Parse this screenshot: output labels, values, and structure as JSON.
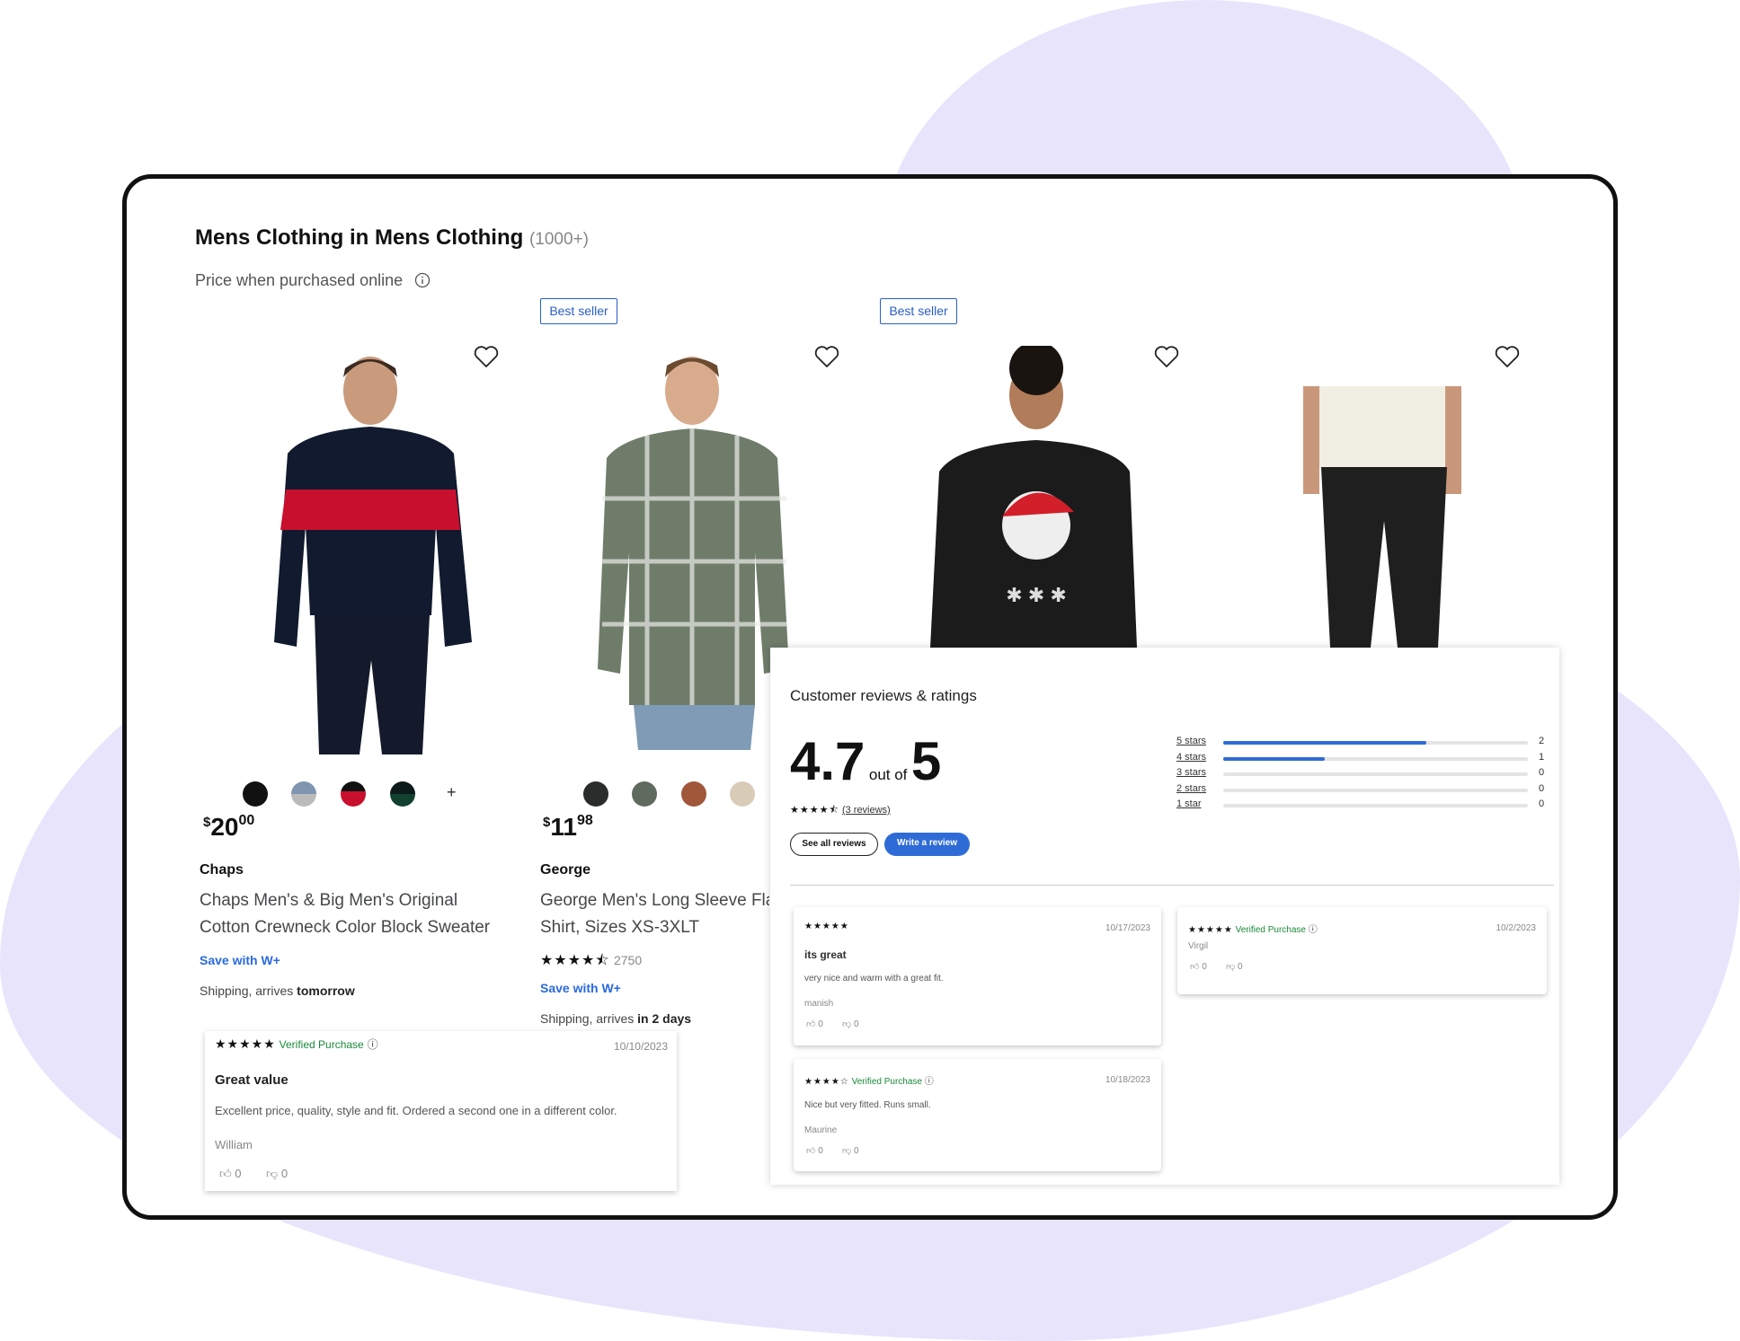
{
  "page": {
    "title": "Mens Clothing in Mens Clothing",
    "count": "(1000+)",
    "subtitle": "Price when purchased online",
    "info_icon": "info-icon"
  },
  "colors": {
    "accent": "#2a6ae0",
    "background_blob": "#e8e4fc",
    "verified": "#1a8a3a"
  },
  "products": [
    {
      "badge": "",
      "brand": "Chaps",
      "price_dollars": "20",
      "price_cents": "00",
      "name_line1": "Chaps Men's & Big Men's Original",
      "name_line2": "Cotton Crewneck Color Block Sweater",
      "rating_text": "",
      "save": "Save with W+",
      "shipping_prefix": "Shipping, arrives ",
      "shipping_bold": "tomorrow",
      "swatches": [
        "#111111",
        "#7f95b0",
        "#c8102e",
        "#12322a"
      ],
      "more_swatches": "+"
    },
    {
      "badge": "Best seller",
      "brand": "George",
      "price_dollars": "11",
      "price_cents": "98",
      "name_line1": "George Men's Long Sleeve Fla",
      "name_line2": "Shirt, Sizes XS-3XLT",
      "rating_stars": "★★★★⯪",
      "rating_count": "2750",
      "save": "Save with W+",
      "shipping_prefix": "Shipping, arrives ",
      "shipping_bold": "in 2 days",
      "swatches": [
        "#2b2d2c",
        "#5f6b5e",
        "#a0573a",
        "#d8cbb8"
      ]
    },
    {
      "badge": "Best seller"
    },
    {
      "badge": ""
    }
  ],
  "floating_review": {
    "stars": "★★★★★",
    "verified": "Verified Purchase",
    "date": "10/10/2023",
    "title": "Great value",
    "body": "Excellent price, quality, style and fit. Ordered a second one in a different color.",
    "author": "William",
    "up": "0",
    "down": "0"
  },
  "reviews_panel": {
    "heading": "Customer reviews & ratings",
    "rating": "4.7",
    "out_of": "out of",
    "max": "5",
    "stars": "★★★★⯪",
    "review_count": "(3 reviews)",
    "see_all": "See all reviews",
    "write": "Write a review",
    "histogram": [
      {
        "label": "5 stars",
        "count": "2",
        "fraction": 0.667
      },
      {
        "label": "4 stars",
        "count": "1",
        "fraction": 0.333
      },
      {
        "label": "3 stars",
        "count": "0",
        "fraction": 0
      },
      {
        "label": "2 stars",
        "count": "0",
        "fraction": 0
      },
      {
        "label": "1 star",
        "count": "0",
        "fraction": 0
      }
    ],
    "reviews": [
      {
        "stars": "★★★★★",
        "verified": "",
        "date": "10/17/2023",
        "title": "its great",
        "body": "very nice and warm with a great fit.",
        "author": "manish",
        "up": "0",
        "down": "0"
      },
      {
        "stars": "★★★★☆",
        "verified": "Verified Purchase",
        "date": "10/18/2023",
        "title": "",
        "body": "Nice but very fitted. Runs small.",
        "author": "Maurine",
        "up": "0",
        "down": "0"
      },
      {
        "stars": "★★★★★",
        "verified": "Verified Purchase",
        "date": "10/2/2023",
        "title": "",
        "body": "",
        "author": "Virgil",
        "up": "0",
        "down": "0"
      }
    ]
  }
}
